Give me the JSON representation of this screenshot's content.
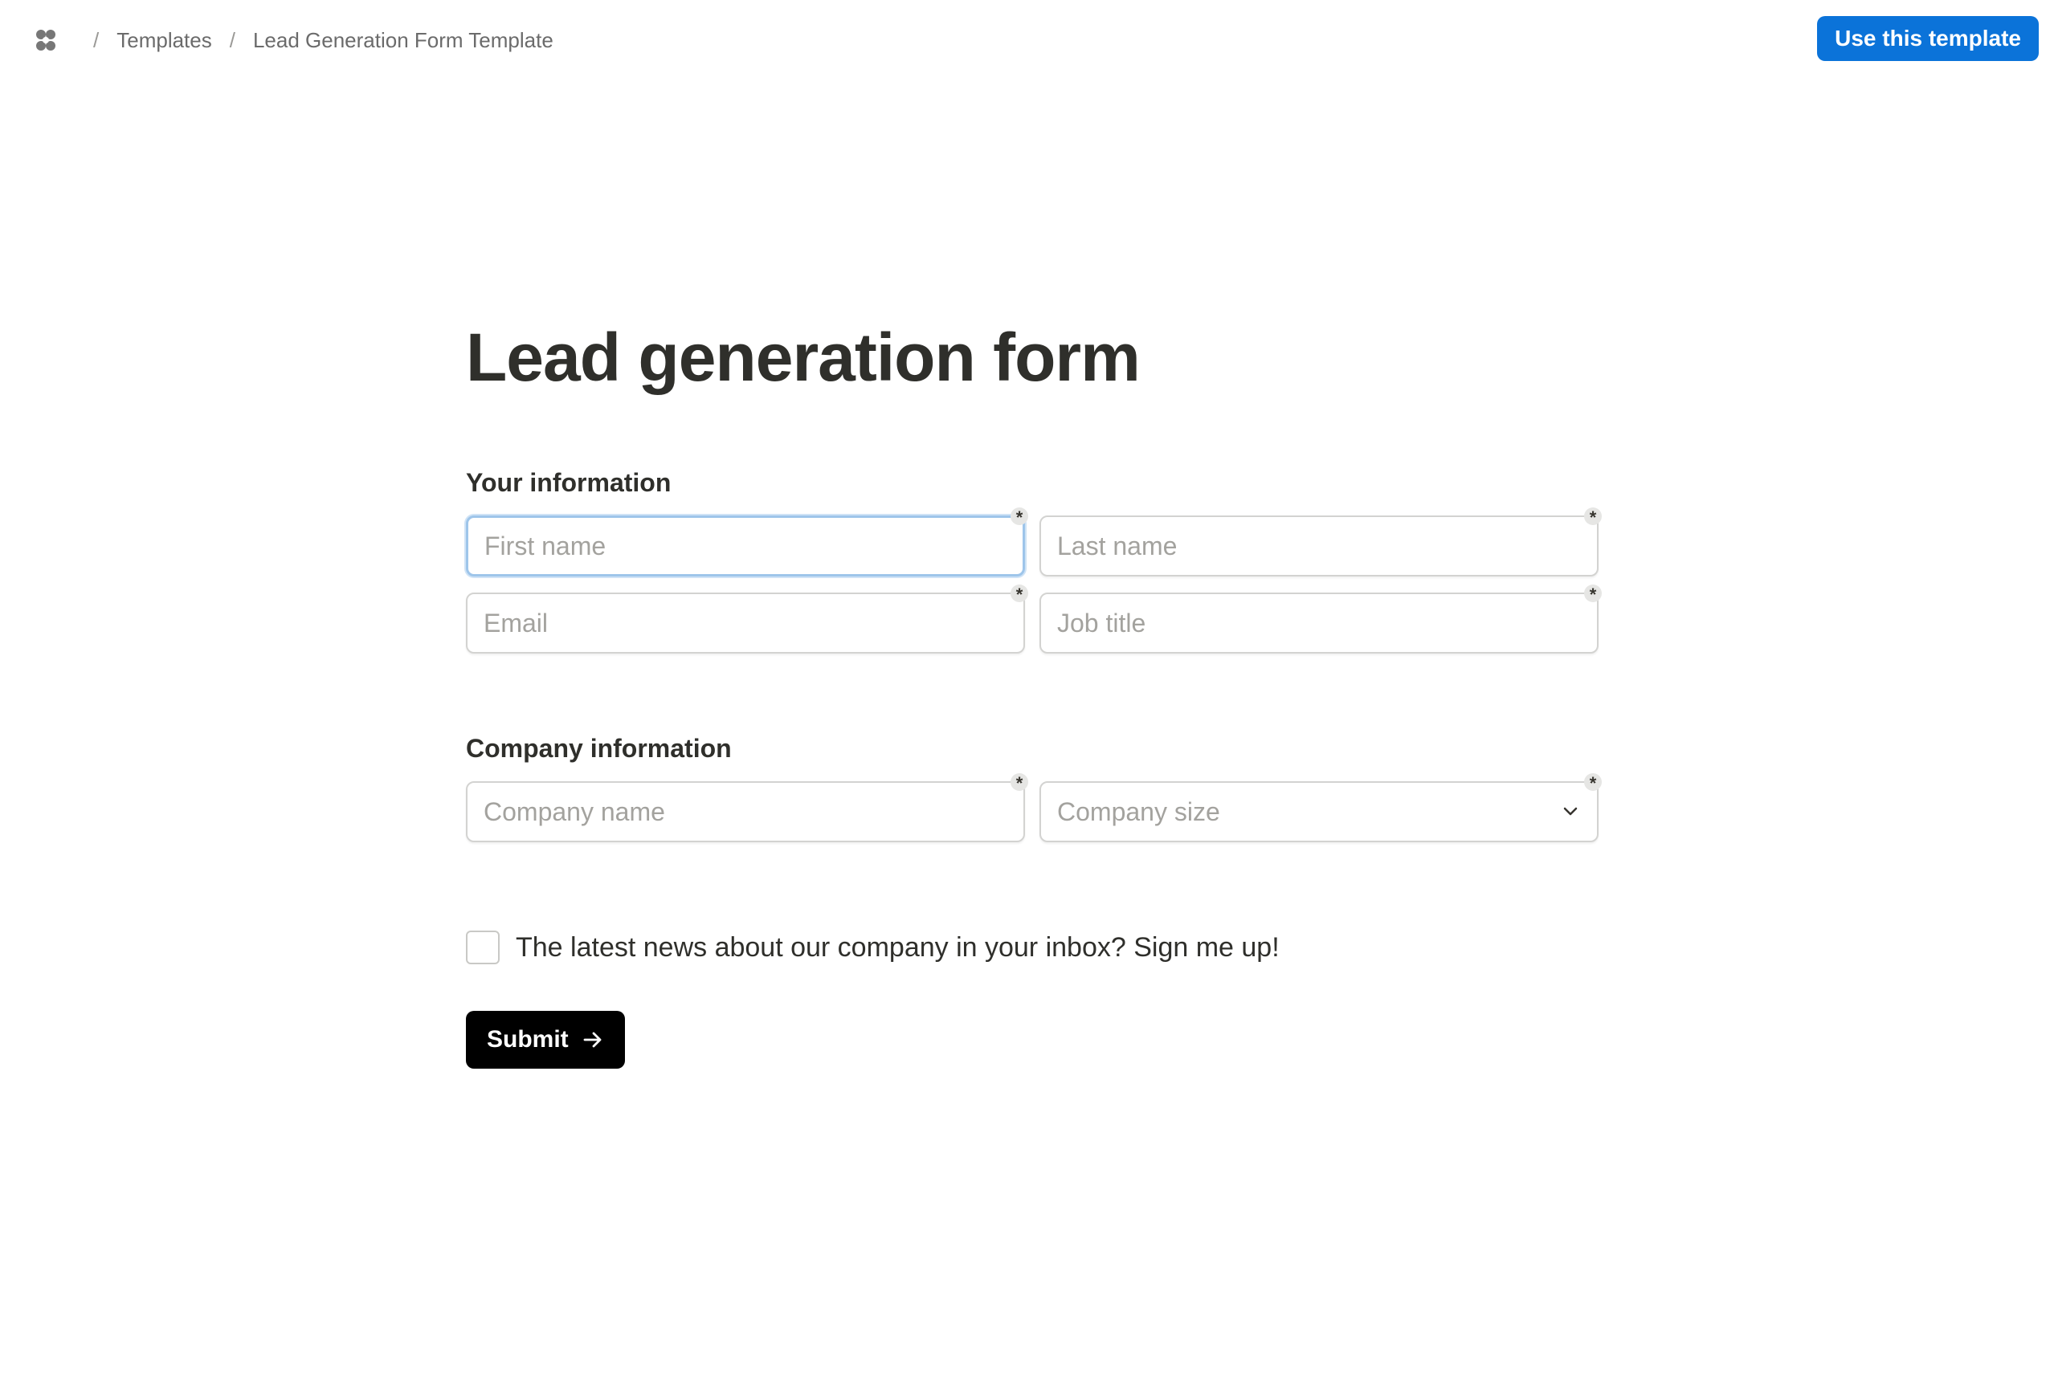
{
  "breadcrumb": {
    "logo_icon": "notion-flower-icon",
    "items": [
      "Templates",
      "Lead Generation Form Template"
    ],
    "separator": "/"
  },
  "header": {
    "use_template_label": "Use this template",
    "accent_color": "#0b73d9"
  },
  "form": {
    "title": "Lead generation form",
    "sections": [
      {
        "title": "Your information",
        "fields": [
          {
            "placeholder": "First name",
            "required": true,
            "focused": true
          },
          {
            "placeholder": "Last name",
            "required": true
          },
          {
            "placeholder": "Email",
            "required": true
          },
          {
            "placeholder": "Job title",
            "required": true
          }
        ]
      },
      {
        "title": "Company information",
        "fields": [
          {
            "placeholder": "Company name",
            "required": true
          },
          {
            "placeholder": "Company size",
            "required": true,
            "type": "select"
          }
        ]
      }
    ],
    "required_marker": "*",
    "newsletter_label": "The latest news about our company in your inbox? Sign me up!",
    "newsletter_checked": false,
    "submit_label": "Submit"
  }
}
